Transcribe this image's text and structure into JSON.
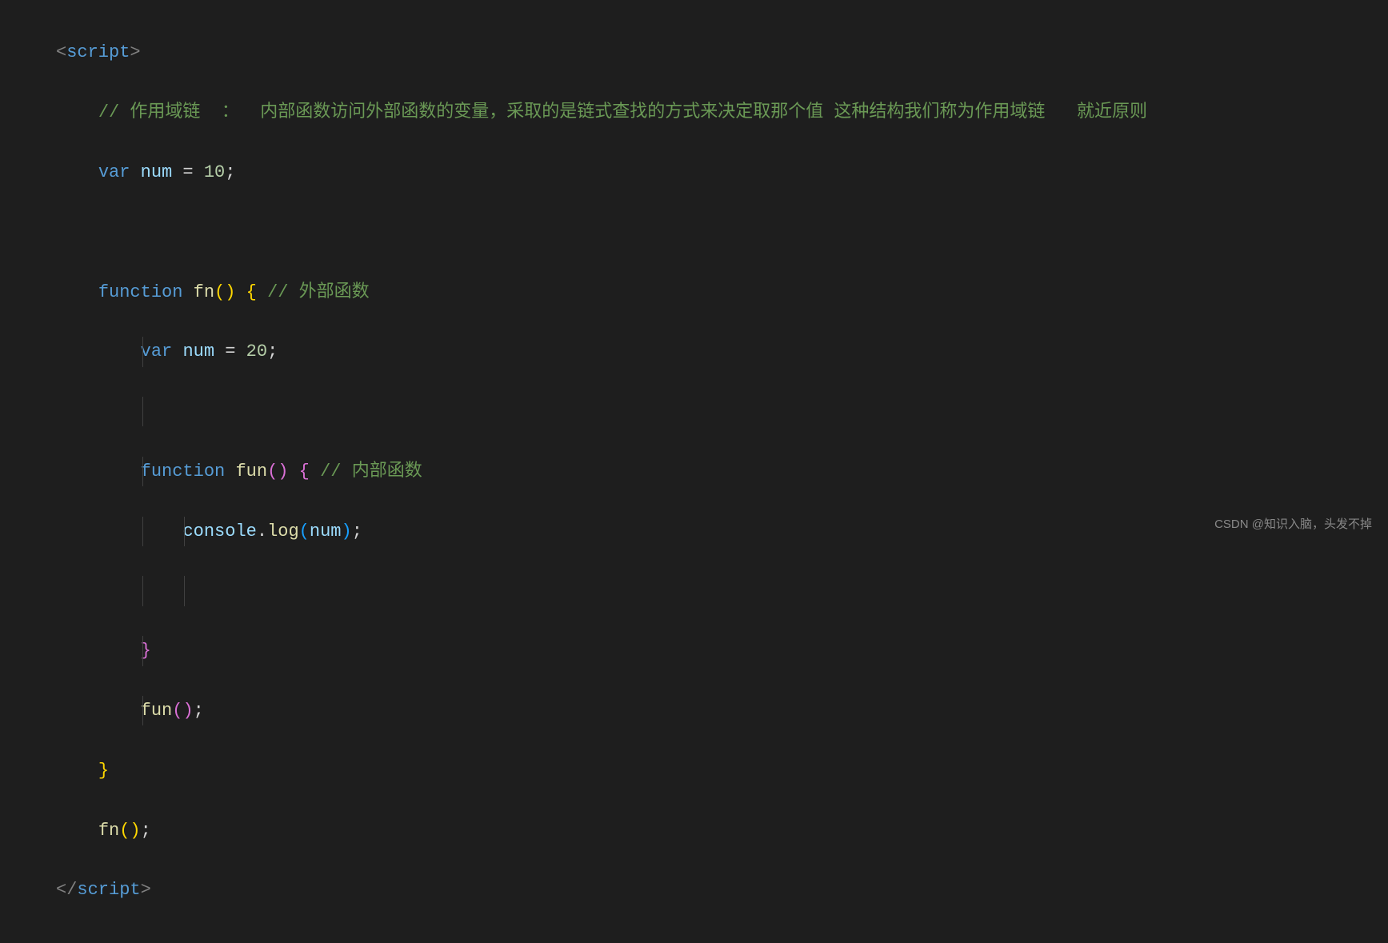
{
  "code": {
    "tag_open_bracket": "<",
    "tag_close_bracket": ">",
    "tag_end_open": "</",
    "script_tag": "script",
    "comment_prefix": "// ",
    "comment_line1": "作用域链  ：  内部函数访问外部函数的变量，采取的是链式查找的方式来决定取那个值 这种结构我们称为作用域链   就近原则",
    "var_keyword": "var",
    "num_var": "num",
    "equals": " = ",
    "val_10": "10",
    "val_20": "20",
    "semicolon": ";",
    "function_keyword": "function",
    "fn_name": "fn",
    "fun_name": "fun",
    "empty_parens_open": "(",
    "empty_parens_close": ")",
    "brace_open": "{",
    "brace_close": "}",
    "comment_outer": "外部函数",
    "comment_inner": "内部函数",
    "console_obj": "console",
    "dot": ".",
    "log_method": "log",
    "num_arg": "num"
  },
  "watermark": "CSDN @知识入脑，头发不掉"
}
